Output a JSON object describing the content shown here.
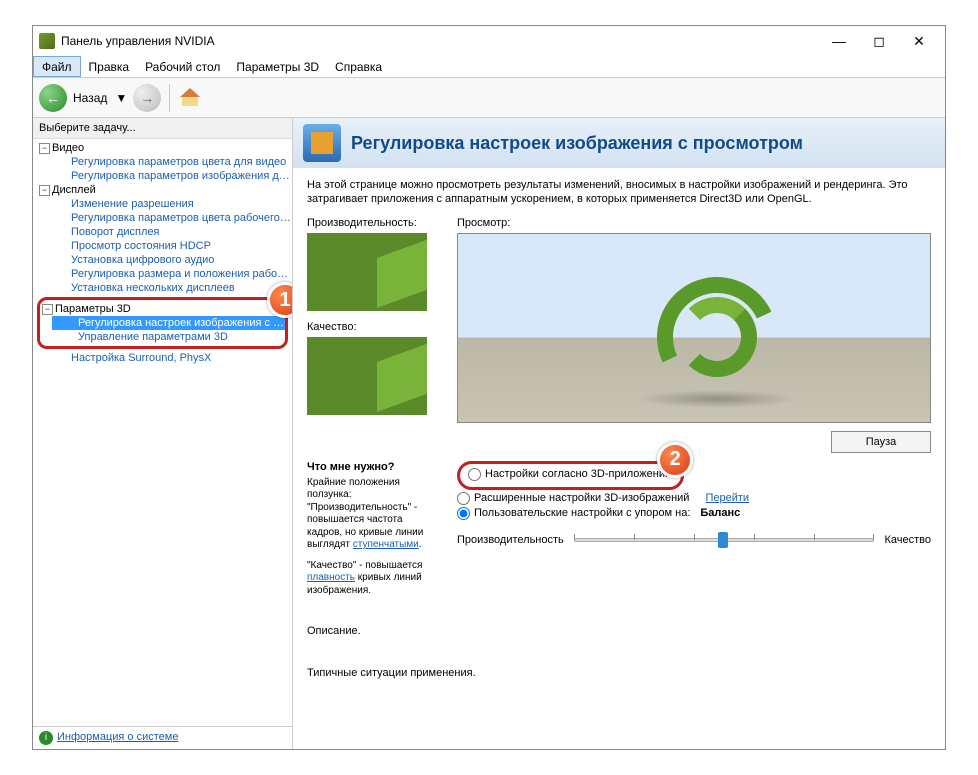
{
  "window": {
    "title": "Панель управления NVIDIA"
  },
  "menu": {
    "file": "Файл",
    "edit": "Правка",
    "desktop": "Рабочий стол",
    "params3d": "Параметры 3D",
    "help": "Справка"
  },
  "toolbar": {
    "back": "Назад",
    "dd": "▼"
  },
  "sidebar": {
    "header": "Выберите задачу...",
    "video": {
      "label": "Видео",
      "items": [
        "Регулировка параметров цвета для видео",
        "Регулировка параметров изображения для видео"
      ]
    },
    "display": {
      "label": "Дисплей",
      "items": [
        "Изменение разрешения",
        "Регулировка параметров цвета рабочего стола",
        "Поворот дисплея",
        "Просмотр состояния HDCP",
        "Установка цифрового аудио",
        "Регулировка размера и положения рабочего стола",
        "Установка нескольких дисплеев"
      ]
    },
    "p3d": {
      "label": "Параметры 3D",
      "items": [
        "Регулировка настроек изображения с просмотром",
        "Управление параметрами 3D",
        "Настройка Surround, PhysX"
      ]
    },
    "sysinfo": "Информация о системе"
  },
  "main": {
    "title": "Регулировка настроек изображения с просмотром",
    "intro": "На этой странице можно просмотреть результаты изменений, вносимых в настройки изображений и рендеринга. Это затрагивает приложения с аппаратным ускорением, в которых применяется Direct3D или OpenGL.",
    "perf_label": "Производительность:",
    "qual_label": "Качество:",
    "preview_label": "Просмотр:",
    "pause": "Пауза",
    "hints": {
      "title": "Что мне нужно?",
      "p1a": "Крайние положения ползунка: \"Производительность\" - повышается частота кадров, но кривые линии выглядят ",
      "p1link": "ступенчатыми",
      "p1b": ".",
      "p2a": "\"Качество\" - повышается ",
      "p2link": "плавность",
      "p2b": " кривых линий изображения."
    },
    "radios": {
      "r1": "Настройки согласно 3D-приложению",
      "r2": "Расширенные настройки 3D-изображений",
      "r3": "Пользовательские настройки с упором на:",
      "go": "Перейти",
      "balance": "Баланс"
    },
    "slider": {
      "left": "Производительность",
      "right": "Качество"
    },
    "desc": "Описание.",
    "typical": "Типичные ситуации применения."
  },
  "badges": {
    "b1": "1",
    "b2": "2"
  }
}
